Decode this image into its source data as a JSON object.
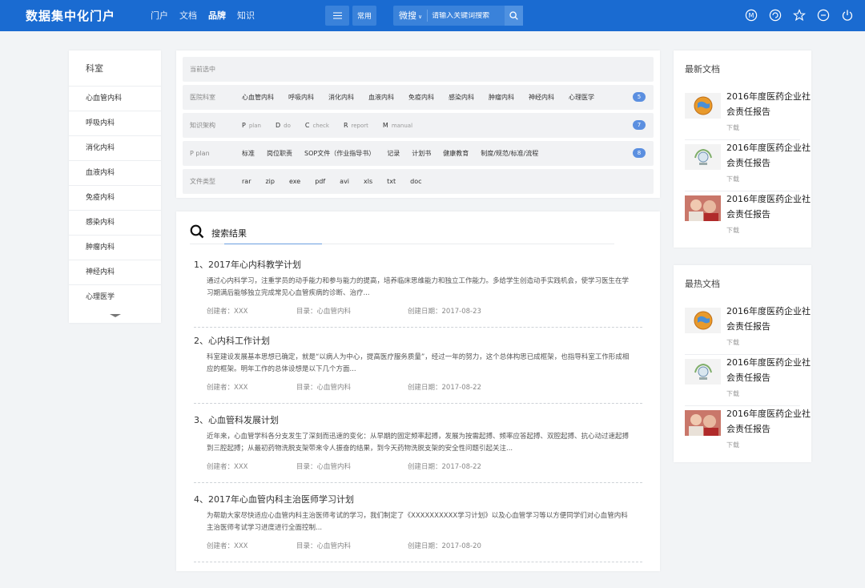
{
  "header": {
    "logo": "数据集中化门户",
    "nav": [
      "门户",
      "文档",
      "品牌",
      "知识"
    ],
    "nav_active_index": 2,
    "common_label": "常用",
    "search_scope": "微搜",
    "search_placeholder": "请输入关键词搜索",
    "icons": [
      "m-circle-icon",
      "refresh-icon",
      "star-icon",
      "minus-circle-icon",
      "power-icon"
    ]
  },
  "departments": {
    "title": "科室",
    "items": [
      "心血管内科",
      "呼吸内科",
      "消化内科",
      "血液内科",
      "免疫内科",
      "感染内科",
      "肿瘤内科",
      "神经内科",
      "心理医学"
    ]
  },
  "filters": {
    "current_label": "当前选中",
    "rows": [
      {
        "label": "医院科室",
        "options": [
          "心血管内科",
          "呼吸内科",
          "消化内科",
          "血液内科",
          "免疫内科",
          "感染内科",
          "肿瘤内科",
          "神经内科",
          "心理医学"
        ],
        "count": "5"
      },
      {
        "label": "知识架构",
        "options": [
          [
            "P",
            "plan"
          ],
          [
            "D",
            "do"
          ],
          [
            "C",
            "check"
          ],
          [
            "R",
            "report"
          ],
          [
            "M",
            "manual"
          ]
        ],
        "count": "7"
      },
      {
        "label": "P  plan",
        "options": [
          "标准",
          "岗位职责",
          "SOP文件（作业指导书）",
          "记录",
          "计划书",
          "健康教育",
          "制度/规范/标准/流程"
        ],
        "count": "8"
      },
      {
        "label": "文件类型",
        "options": [
          "rar",
          "zip",
          "exe",
          "pdf",
          "avi",
          "xls",
          "txt",
          "doc"
        ],
        "count": ""
      }
    ]
  },
  "results": {
    "title": "搜索结果",
    "items": [
      {
        "title": "1、2017年心内科教学计划",
        "desc": "通过心内科学习，注重学员的动手能力和参与能力的提高，培养临床思维能力和独立工作能力。多给学生创造动手实践机会，使学习医生在学习期满后能够独立完成常见心血管疾病的诊断、治疗...",
        "author": "创建者：XXX",
        "dir": "目录：心血管内科",
        "date": "创建日期：2017-08-23"
      },
      {
        "title": "2、心内科工作计划",
        "desc": "科室建设发展基本思想已确定，就是“以病人为中心，提高医疗服务质量”，经过一年的努力，这个总体构思已成框架，也指导科室工作形成相应的框架。明年工作的总体设想是以下几个方面...",
        "author": "创建者：XXX",
        "dir": "目录：心血管内科",
        "date": "创建日期：2017-08-22"
      },
      {
        "title": "3、心血管科发展计划",
        "desc": "近年来，心血管学科各分支发生了深刻而迅速的变化：从早期的固定频率起搏，发展为按需起搏、频率应答起搏、双腔起搏、抗心动过速起搏到三腔起搏；从最初药物洗脱支架带来令人振奋的结果，到今天药物洗脱支架的安全性问题引起关注...",
        "author": "创建者：XXX",
        "dir": "目录：心血管内科",
        "date": "创建日期：2017-08-22"
      },
      {
        "title": "4、2017年心血管内科主治医师学习计划",
        "desc": "为帮助大家尽快适应心血管内科主治医师考试的学习，我们制定了《XXXXXXXXXX学习计划》以及心血管学习等以方便同学们对心血管内科主治医师考试学习进度进行全面控制...",
        "author": "创建者：XXX",
        "dir": "目录：心血管内科",
        "date": "创建日期：2017-08-20"
      }
    ]
  },
  "latest_docs": {
    "title": "最新文档",
    "items": [
      {
        "title": "2016年度医药企业社会责任报告",
        "action": "下载",
        "thumb": "globe"
      },
      {
        "title": "2016年度医药企业社会责任报告",
        "action": "下载",
        "thumb": "emblem"
      },
      {
        "title": "2016年度医药企业社会责任报告",
        "action": "下载",
        "thumb": "photo"
      }
    ]
  },
  "hot_docs": {
    "title": "最热文档",
    "items": [
      {
        "title": "2016年度医药企业社会责任报告",
        "action": "下载",
        "thumb": "globe"
      },
      {
        "title": "2016年度医药企业社会责任报告",
        "action": "下载",
        "thumb": "emblem"
      },
      {
        "title": "2016年度医药企业社会责任报告",
        "action": "下载",
        "thumb": "photo"
      }
    ]
  },
  "colors": {
    "primary": "#1a6bd1",
    "badge": "#5b8fe0",
    "page_bg": "#f2f4f6"
  }
}
